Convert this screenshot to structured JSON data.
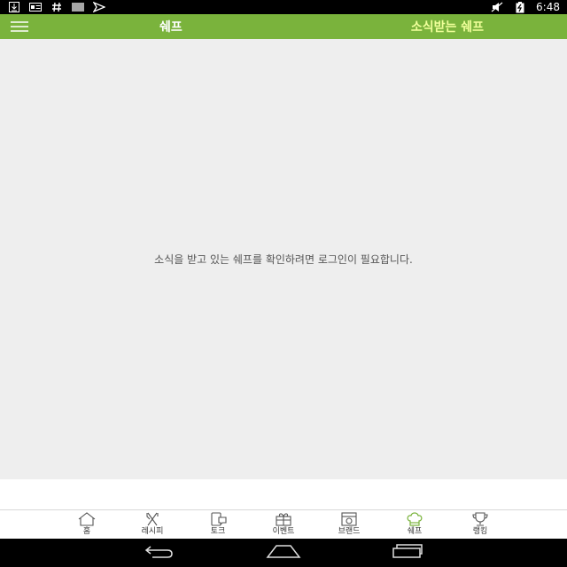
{
  "status_bar": {
    "time": "6:48",
    "left_icons": [
      "download-icon",
      "card-icon",
      "hash-icon",
      "barcode-icon",
      "send-icon"
    ],
    "right_icons": [
      "mute-icon",
      "battery-icon"
    ]
  },
  "app_bar": {
    "title": "쉐프",
    "subscribe_label": "소식받는 쉐프",
    "background": "#7ab33c",
    "subscribe_color": "#f0ff9a"
  },
  "content": {
    "message": "소식을 받고 있는 쉐프를 확인하려면 로그인이 필요합니다."
  },
  "bottom_nav": {
    "items": [
      {
        "label": "홈",
        "icon": "home-icon"
      },
      {
        "label": "레시피",
        "icon": "utensils-icon"
      },
      {
        "label": "토크",
        "icon": "chat-icon"
      },
      {
        "label": "이벤트",
        "icon": "gift-icon"
      },
      {
        "label": "브랜드",
        "icon": "brand-icon"
      },
      {
        "label": "쉐프",
        "icon": "chef-hat-icon",
        "active": true
      },
      {
        "label": "랭킹",
        "icon": "trophy-icon"
      }
    ],
    "active_color": "#7ab33c"
  },
  "system_nav": {
    "buttons": [
      "back-icon",
      "home-outline-icon",
      "recents-icon"
    ]
  }
}
